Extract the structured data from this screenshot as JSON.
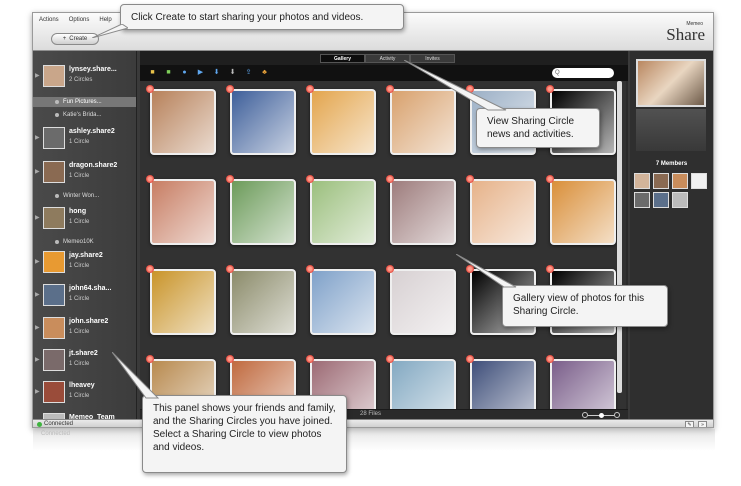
{
  "menu": [
    "Actions",
    "Options",
    "Help"
  ],
  "create_button": "Create",
  "brand": {
    "small": "Memeo",
    "big": "Share"
  },
  "sidebar": {
    "friends": [
      {
        "name": "lynsey.share...",
        "sub": "2 Circles",
        "avatar_color": "#c9a68a"
      },
      {
        "name": "ashley.share2",
        "sub": "1 Circle",
        "avatar_color": "#6b6b6b"
      },
      {
        "name": "dragon.share2",
        "sub": "1 Circle",
        "avatar_color": "#8a6a52"
      },
      {
        "name": "hong",
        "sub": "1 Circle",
        "avatar_color": "#8e7b5e"
      },
      {
        "name": "jay.share2",
        "sub": "1 Circle",
        "avatar_color": "#e89a32"
      },
      {
        "name": "john64.sha...",
        "sub": "1 Circle",
        "avatar_color": "#5b6f8a"
      },
      {
        "name": "john.share2",
        "sub": "1 Circle",
        "avatar_color": "#c98d5c"
      },
      {
        "name": "jt.share2",
        "sub": "1 Circle",
        "avatar_color": "#7a6a6a"
      },
      {
        "name": "lheavey",
        "sub": "1 Circle",
        "avatar_color": "#9a4c3a"
      },
      {
        "name": "Memeo_Team",
        "sub": "",
        "avatar_color": "#bcbcbc"
      }
    ],
    "circles": [
      {
        "label": "Fun Pictures...",
        "active": true
      },
      {
        "label": "Katie's Brida...",
        "active": false
      },
      {
        "label": "Winter Won...",
        "active": false
      },
      {
        "label": "Memeo10K",
        "active": false
      }
    ]
  },
  "tabs": [
    {
      "label": "Gallery",
      "active": true
    },
    {
      "label": "Activity",
      "active": false
    },
    {
      "label": "Invites",
      "active": false
    }
  ],
  "toolbar_icons": [
    "add-photo-icon",
    "add-circle-icon",
    "comment-icon",
    "play-icon",
    "download-icon",
    "download-all-icon",
    "share-icon",
    "members-icon"
  ],
  "search_placeholder": "Q",
  "status": {
    "file_count": "28 Files",
    "zoom_level": 0.5
  },
  "members": {
    "title": "7 Members",
    "avatar_colors": [
      "#d2b49a",
      "#8a6a52",
      "#c98d5c",
      "#f0f0f0",
      "#6b6b6b",
      "#5b6f8a",
      "#bcbcbc"
    ]
  },
  "bottom_bar": {
    "status": "Connected"
  },
  "reflection": {
    "status": "Connected"
  },
  "photos": [
    "#b7815a",
    "#3e5f9a",
    "#e3a54d",
    "#d8a16d",
    "#9cb0c6",
    "#000000",
    "#000000",
    "#000000",
    "#c77d63",
    "#6c9b5a",
    "#9bbf7d",
    "#9d7c7c",
    "#e6b289",
    "#d98f3a",
    "#000000",
    "#000000",
    "#c9942a",
    "#8b8b6a",
    "#7fa1c9",
    "#d7d0d2",
    "#000000",
    "#000000",
    "#000000",
    "#000000",
    "#b88a4f",
    "#c06a3f",
    "#9c6a74",
    "#83a9c2",
    "#3f4f7a",
    "#7a5e8a",
    "#000000",
    "#000000"
  ],
  "callouts": {
    "create": "Click Create to start sharing your photos and videos.",
    "activity": "View Sharing Circle news and activities.",
    "gallery": "Gallery view of photos for this Sharing Circle.",
    "panel": "This panel shows your friends and family, and the Sharing Circles you have joined. Select a Sharing Circle to view photos and videos."
  }
}
